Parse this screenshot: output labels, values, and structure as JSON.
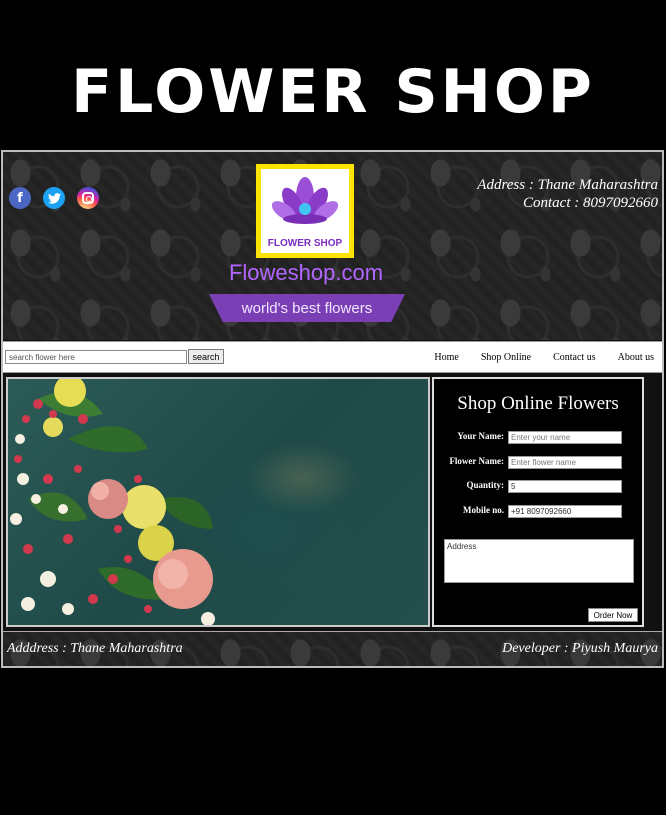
{
  "banner": {
    "title": "FLOWER SHOP"
  },
  "header": {
    "social": [
      {
        "name": "facebook-icon",
        "glyph": "f"
      },
      {
        "name": "twitter-icon",
        "glyph": "t"
      },
      {
        "name": "instagram-icon",
        "glyph": ""
      }
    ],
    "logo_text": "FLOWER SHOP",
    "site_name": "Floweshop.com",
    "tagline": "world's best flowers",
    "address": "Address : Thane Maharashtra",
    "contact": "Contact : 8097092660"
  },
  "nav": {
    "search_placeholder": "search flower here",
    "search_button": "search",
    "links": [
      "Home",
      "Shop Online",
      "Contact us",
      "About us"
    ]
  },
  "order_form": {
    "title": "Shop Online Flowers",
    "fields": [
      {
        "label": "Your Name:",
        "placeholder": "Enter your name",
        "value": ""
      },
      {
        "label": "Flower Name:",
        "placeholder": "Enter flower name",
        "value": ""
      },
      {
        "label": "Quantity:",
        "placeholder": "",
        "value": "5"
      },
      {
        "label": "Mobile no.",
        "placeholder": "",
        "value": "+91 8097092660"
      }
    ],
    "address_placeholder": "Address",
    "order_button": "Order Now"
  },
  "footer": {
    "address": "Adddress : Thane Maharashtra",
    "developer": "Developer : Piyush Maurya"
  },
  "colors": {
    "accent_purple": "#b366ff",
    "ribbon_purple": "#7a3fb5",
    "logo_yellow": "#fbe400",
    "background": "#000000"
  }
}
